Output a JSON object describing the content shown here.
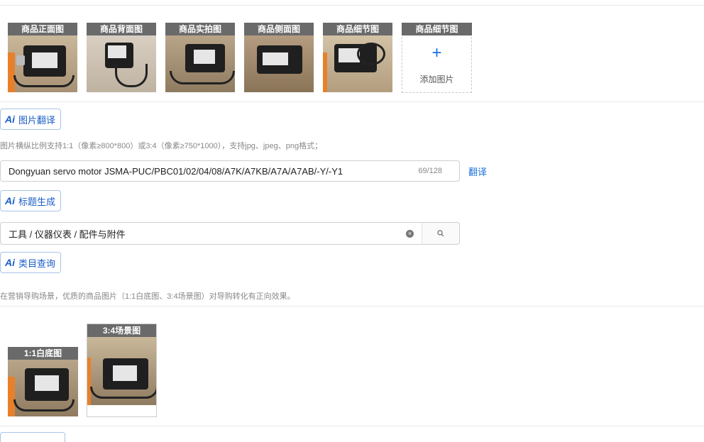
{
  "product_images": [
    {
      "caption": "商品正面图"
    },
    {
      "caption": "商品背面图"
    },
    {
      "caption": "商品实拍图"
    },
    {
      "caption": "商品侧面图"
    },
    {
      "caption": "商品细节图"
    }
  ],
  "add_image": {
    "caption": "商品细节图",
    "plus": "+",
    "label": "添加图片"
  },
  "ai_image_translate": {
    "ai": "Ai",
    "label": "图片翻译"
  },
  "image_hint": "图片横纵比例支持1:1（像素≥800*800）或3:4（像素≥750*1000），支持jpg、jpeg、png格式；",
  "title_input": {
    "value": "Dongyuan servo motor JSMA-PUC/PBC01/02/04/08/A7K/A7KB/A7A/A7AB/-Y/-Y1",
    "count": "69/128"
  },
  "translate_link": "翻译",
  "ai_title": {
    "ai": "Ai",
    "label": "标题生成"
  },
  "category_input": {
    "value": "工具 / 仪器仪表 / 配件与附件",
    "clear": "×"
  },
  "ai_category": {
    "ai": "Ai",
    "label": "类目查询"
  },
  "marketing_hint": "在营销导购场景，优质的商品图片（1:1白底图、3:4场景图）对导购转化有正向效果。",
  "scene_images": [
    {
      "caption": "1:1白底图"
    },
    {
      "caption": "3:4场景图"
    }
  ],
  "colors": {
    "accent": "#1a6fd8",
    "caption_bg": "#5a5a5a",
    "border": "#cfcfcf"
  }
}
